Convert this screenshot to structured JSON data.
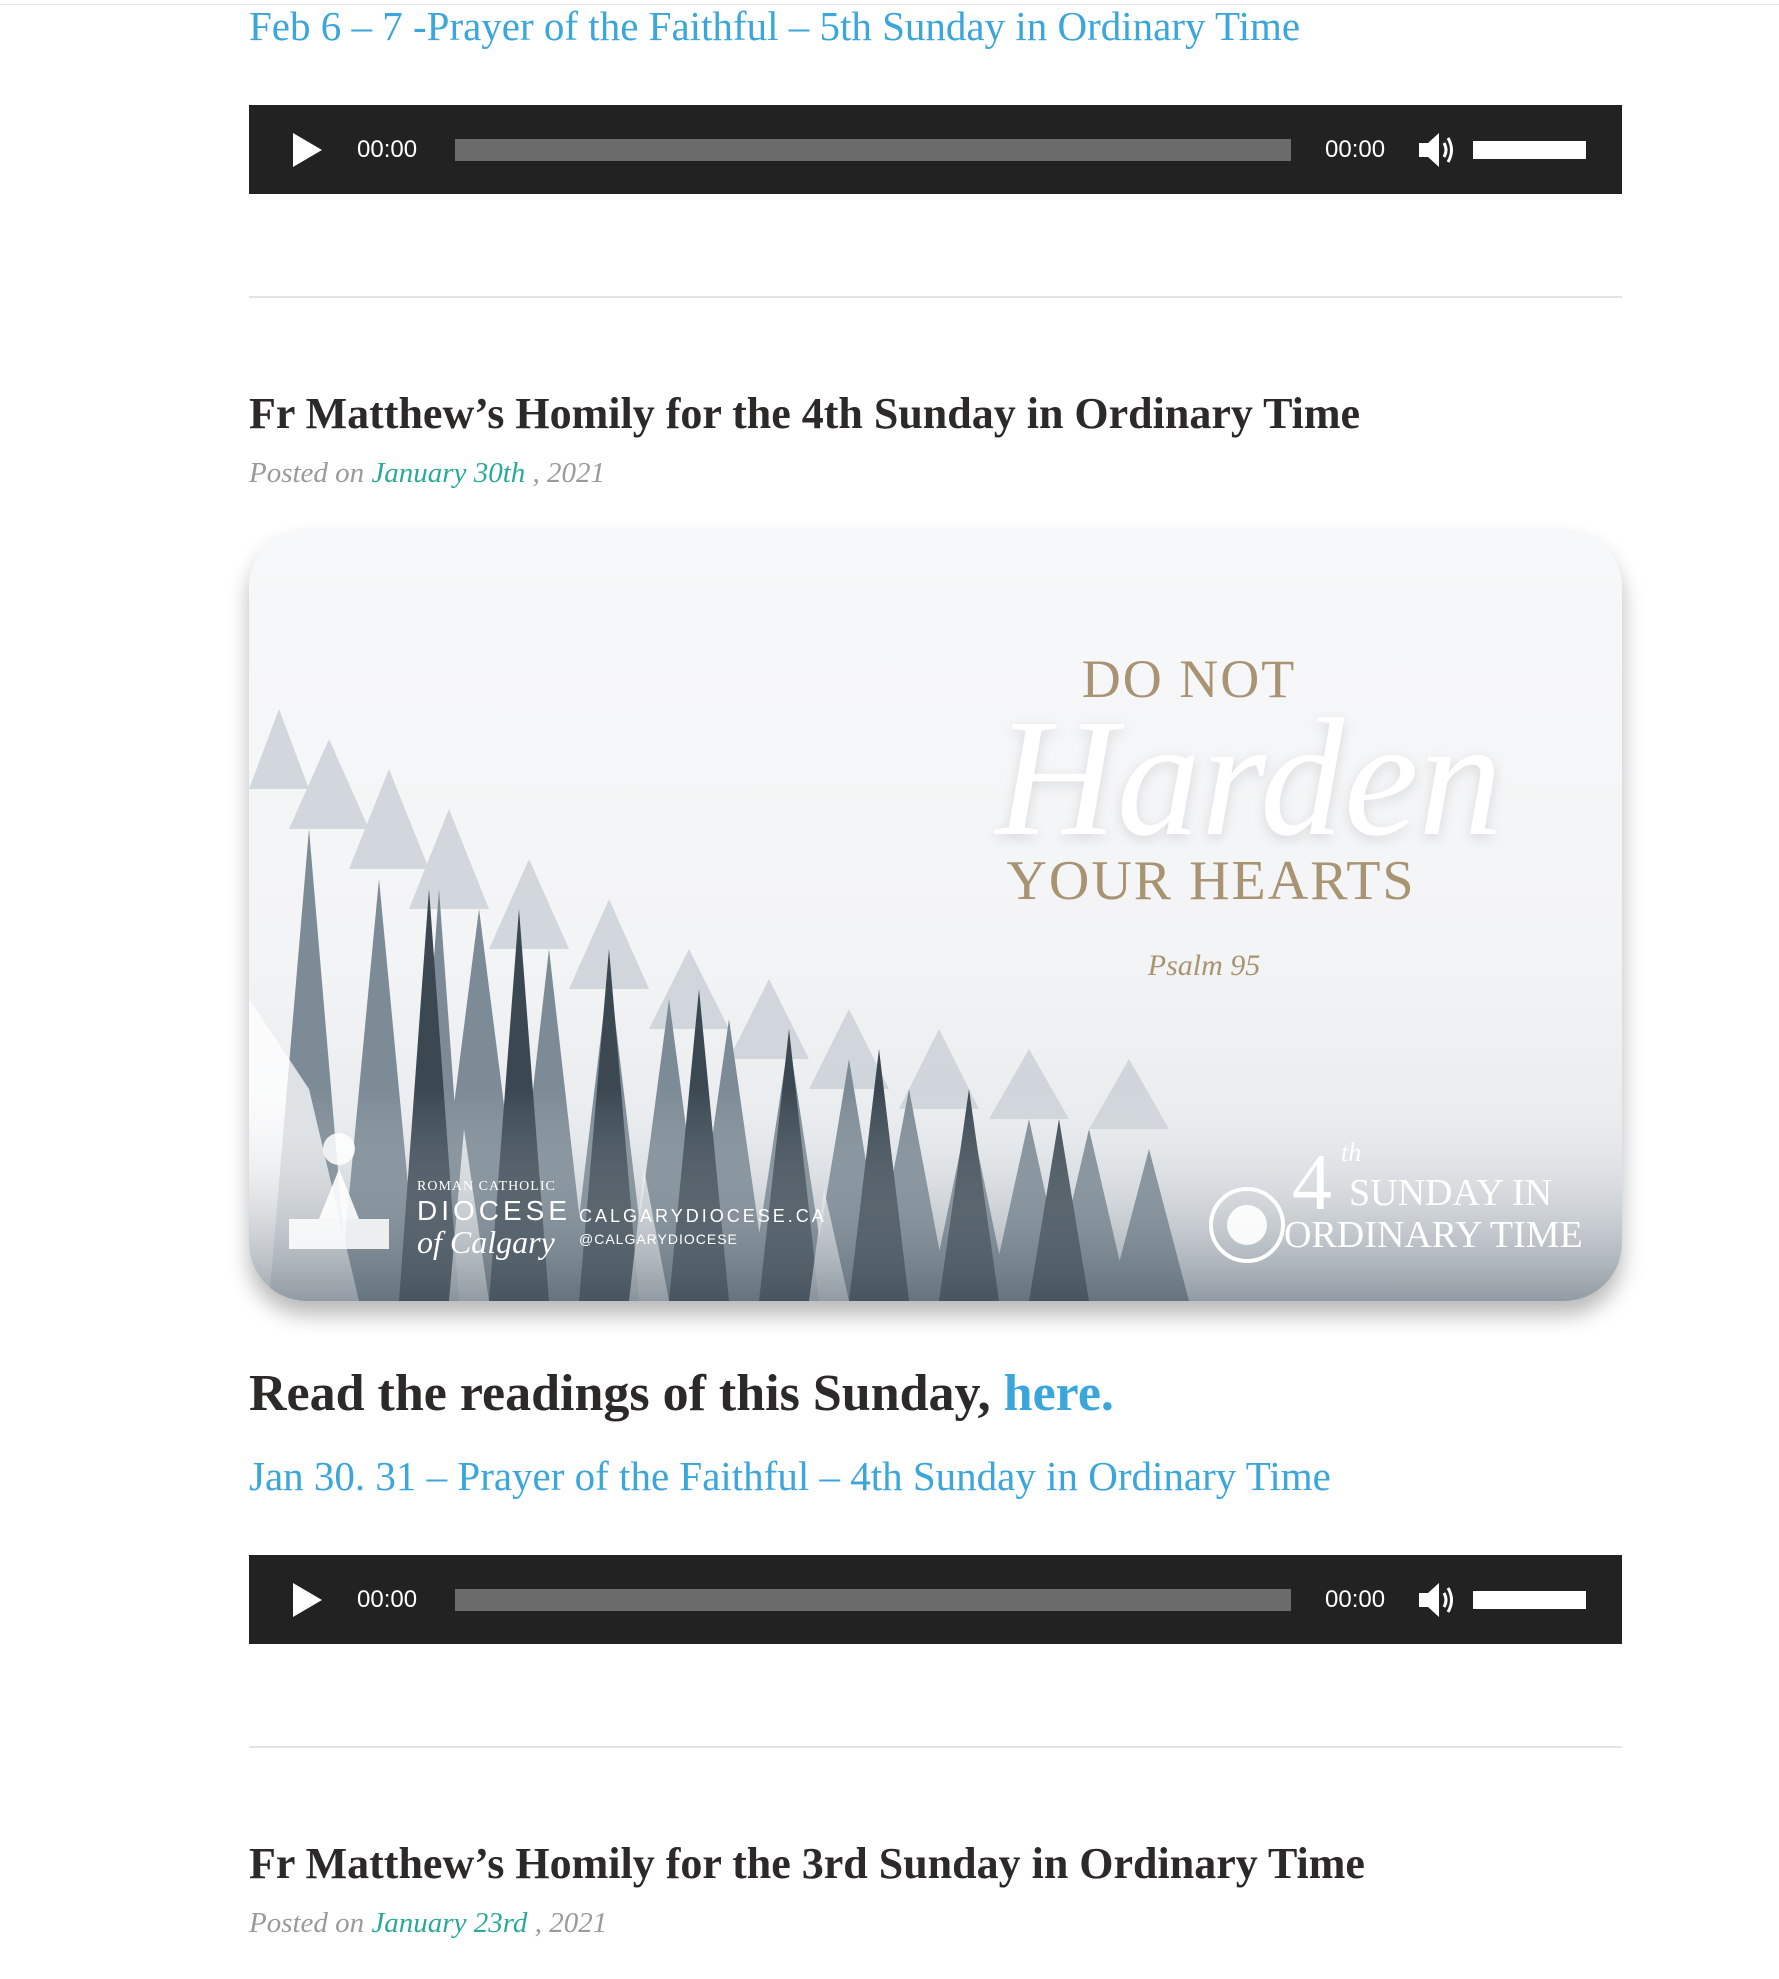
{
  "posts": [
    {
      "audio_link": "Feb 6 – 7 -Prayer of the Faithful – 5th Sunday in Ordinary Time",
      "player": {
        "current_time": "00:00",
        "duration": "00:00",
        "progress": 0,
        "volume": 1
      }
    },
    {
      "title": "Fr Matthew’s Homily for the 4th Sunday in Ordinary Time",
      "posted_label": "Posted on",
      "date": "January 30th",
      "year": ", 2021",
      "image": {
        "line1": "DO NOT",
        "line2": "Harden",
        "line3": "YOUR HEARTS",
        "citation": "Psalm 95",
        "badge_number": "4",
        "badge_sup": "th",
        "badge_line1": "SUNDAY IN",
        "badge_line2": "ORDINARY TIME",
        "logo_top": "ROMAN CATHOLIC",
        "logo_main": "DIOCESE",
        "logo_sub": "of Calgary",
        "website": "CALGARYDIOCESE.CA",
        "social": "@CALGARYDIOCESE"
      },
      "readings_text": "Read the readings of this Sunday, ",
      "readings_link": "here.",
      "audio_link": "Jan 30. 31 – Prayer of the Faithful – 4th Sunday in Ordinary Time",
      "player": {
        "current_time": "00:00",
        "duration": "00:00",
        "progress": 0,
        "volume": 1
      }
    },
    {
      "title": "Fr Matthew’s Homily for the 3rd Sunday in Ordinary Time",
      "posted_label": "Posted on",
      "date": "January 23rd",
      "year": ", 2021"
    }
  ],
  "colors": {
    "link": "#3ba6db",
    "date_link": "#2aa99a",
    "player_bg": "#222222",
    "title": "#2b2a29"
  }
}
